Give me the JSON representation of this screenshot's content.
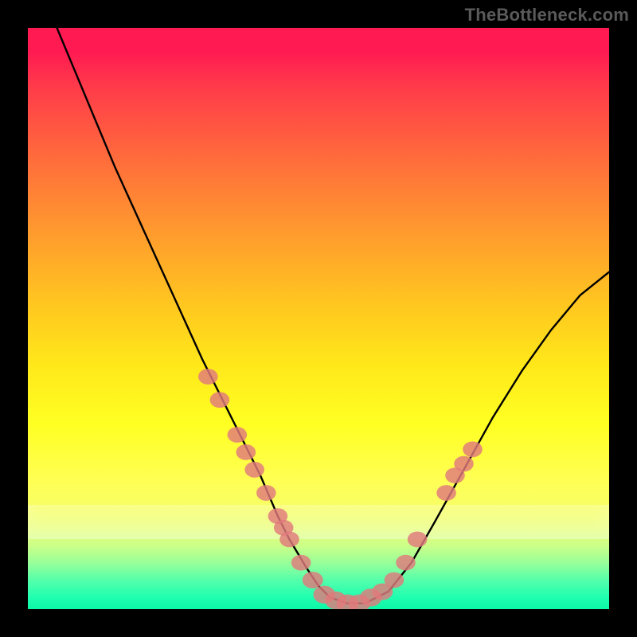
{
  "watermark": "TheBottleneck.com",
  "chart_data": {
    "type": "line",
    "title": "",
    "xlabel": "",
    "ylabel": "",
    "xlim": [
      0,
      100
    ],
    "ylim": [
      0,
      100
    ],
    "series": [
      {
        "name": "curve",
        "x": [
          5,
          10,
          15,
          20,
          25,
          30,
          35,
          40,
          43,
          45,
          48,
          50,
          52,
          55,
          58,
          62,
          66,
          70,
          75,
          80,
          85,
          90,
          95,
          100
        ],
        "y": [
          100,
          88,
          76,
          65,
          54,
          43,
          33,
          23,
          16,
          12,
          7,
          4,
          2,
          1,
          1,
          3,
          8,
          15,
          24,
          33,
          41,
          48,
          54,
          58
        ]
      }
    ],
    "markers": [
      {
        "x": 31,
        "y": 40,
        "r": 1.6
      },
      {
        "x": 33,
        "y": 36,
        "r": 1.6
      },
      {
        "x": 36,
        "y": 30,
        "r": 1.6
      },
      {
        "x": 37.5,
        "y": 27,
        "r": 1.6
      },
      {
        "x": 39,
        "y": 24,
        "r": 1.6
      },
      {
        "x": 41,
        "y": 20,
        "r": 1.6
      },
      {
        "x": 43,
        "y": 16,
        "r": 1.6
      },
      {
        "x": 45,
        "y": 12,
        "r": 1.6
      },
      {
        "x": 44,
        "y": 14,
        "r": 1.6
      },
      {
        "x": 47,
        "y": 8,
        "r": 1.6
      },
      {
        "x": 49,
        "y": 5,
        "r": 1.7
      },
      {
        "x": 51,
        "y": 2.5,
        "r": 1.8
      },
      {
        "x": 53,
        "y": 1.5,
        "r": 1.8
      },
      {
        "x": 55,
        "y": 1,
        "r": 1.8
      },
      {
        "x": 57,
        "y": 1,
        "r": 1.8
      },
      {
        "x": 59,
        "y": 2,
        "r": 1.8
      },
      {
        "x": 61,
        "y": 3,
        "r": 1.7
      },
      {
        "x": 63,
        "y": 5,
        "r": 1.6
      },
      {
        "x": 65,
        "y": 8,
        "r": 1.6
      },
      {
        "x": 67,
        "y": 12,
        "r": 1.6
      },
      {
        "x": 72,
        "y": 20,
        "r": 1.6
      },
      {
        "x": 73.5,
        "y": 23,
        "r": 1.6
      },
      {
        "x": 75,
        "y": 25,
        "r": 1.6
      },
      {
        "x": 76.5,
        "y": 27.5,
        "r": 1.6
      }
    ],
    "colors": {
      "curve": "#000000",
      "markers": "#e17a7c",
      "gradient_top": "#ff1a52",
      "gradient_bottom": "#0cf7a6"
    }
  }
}
